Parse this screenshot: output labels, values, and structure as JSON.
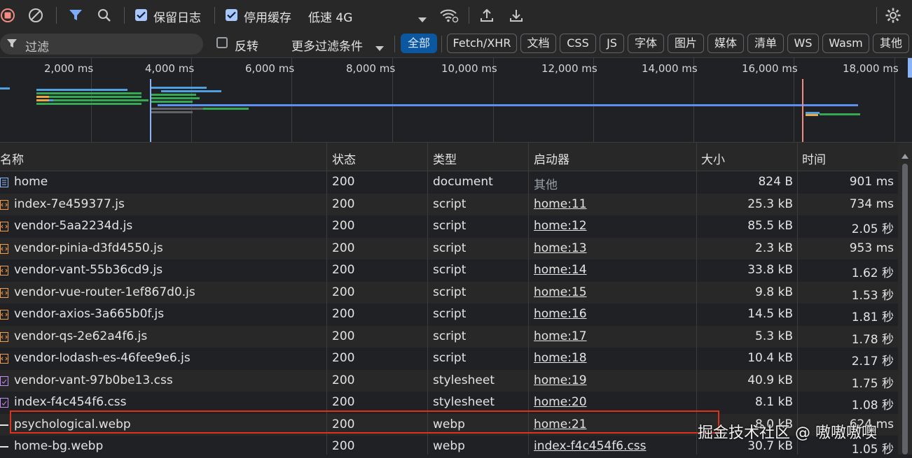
{
  "toolbar": {
    "preserve_log_label": "保留日志",
    "disable_cache_label": "停用缓存",
    "throttle_label": "低速 4G"
  },
  "filterbar": {
    "filter_placeholder": "过滤",
    "invert_label": "反转",
    "more_filters_label": "更多过滤条件",
    "chips": [
      "全部",
      "Fetch/XHR",
      "文档",
      "CSS",
      "JS",
      "字体",
      "图片",
      "媒体",
      "清单",
      "WS",
      "Wasm",
      "其他"
    ]
  },
  "overview": {
    "ticks": [
      "2,000 ms",
      "4,000 ms",
      "6,000 ms",
      "8,000 ms",
      "10,000 ms",
      "12,000 ms",
      "14,000 ms",
      "16,000 ms",
      "18,000 ms"
    ]
  },
  "table": {
    "headers": [
      "名称",
      "状态",
      "类型",
      "启动器",
      "大小",
      "时间"
    ],
    "rows": [
      {
        "name": "home",
        "status": "200",
        "type": "document",
        "initiator": "其他",
        "size": "824 B",
        "time": "901 ms",
        "icon": "document-icon"
      },
      {
        "name": "index-7e459377.js",
        "status": "200",
        "type": "script",
        "initiator": "home:11",
        "size": "25.3 kB",
        "time": "734 ms",
        "icon": "script-icon"
      },
      {
        "name": "vendor-5aa2234d.js",
        "status": "200",
        "type": "script",
        "initiator": "home:12",
        "size": "85.5 kB",
        "time": "2.05 秒",
        "icon": "script-icon"
      },
      {
        "name": "vendor-pinia-d3fd4550.js",
        "status": "200",
        "type": "script",
        "initiator": "home:13",
        "size": "2.3 kB",
        "time": "953 ms",
        "icon": "script-icon"
      },
      {
        "name": "vendor-vant-55b36cd9.js",
        "status": "200",
        "type": "script",
        "initiator": "home:14",
        "size": "33.8 kB",
        "time": "1.62 秒",
        "icon": "script-icon"
      },
      {
        "name": "vendor-vue-router-1ef867d0.js",
        "status": "200",
        "type": "script",
        "initiator": "home:15",
        "size": "9.8 kB",
        "time": "1.53 秒",
        "icon": "script-icon"
      },
      {
        "name": "vendor-axios-3a665b0f.js",
        "status": "200",
        "type": "script",
        "initiator": "home:16",
        "size": "14.5 kB",
        "time": "1.81 秒",
        "icon": "script-icon"
      },
      {
        "name": "vendor-qs-2e62a4f6.js",
        "status": "200",
        "type": "script",
        "initiator": "home:17",
        "size": "5.3 kB",
        "time": "1.78 秒",
        "icon": "script-icon"
      },
      {
        "name": "vendor-lodash-es-46fee9e6.js",
        "status": "200",
        "type": "script",
        "initiator": "home:18",
        "size": "10.4 kB",
        "time": "2.17 秒",
        "icon": "script-icon"
      },
      {
        "name": "vendor-vant-97b0be13.css",
        "status": "200",
        "type": "stylesheet",
        "initiator": "home:19",
        "size": "40.9 kB",
        "time": "1.75 秒",
        "icon": "stylesheet-icon"
      },
      {
        "name": "index-f4c454f6.css",
        "status": "200",
        "type": "stylesheet",
        "initiator": "home:20",
        "size": "8.1 kB",
        "time": "1.08 秒",
        "icon": "stylesheet-icon"
      },
      {
        "name": "psychological.webp",
        "status": "200",
        "type": "webp",
        "initiator": "home:21",
        "size": "8.0 kB",
        "time": "624 ms",
        "icon": "image-icon"
      },
      {
        "name": "home-bg.webp",
        "status": "200",
        "type": "webp",
        "initiator": "index-f4c454f6.css",
        "size": "30.7 kB",
        "time": "1.05 秒",
        "icon": "image-icon"
      }
    ]
  },
  "watermark": "掘金技术社区 @ 嗷嗷嗷噢"
}
